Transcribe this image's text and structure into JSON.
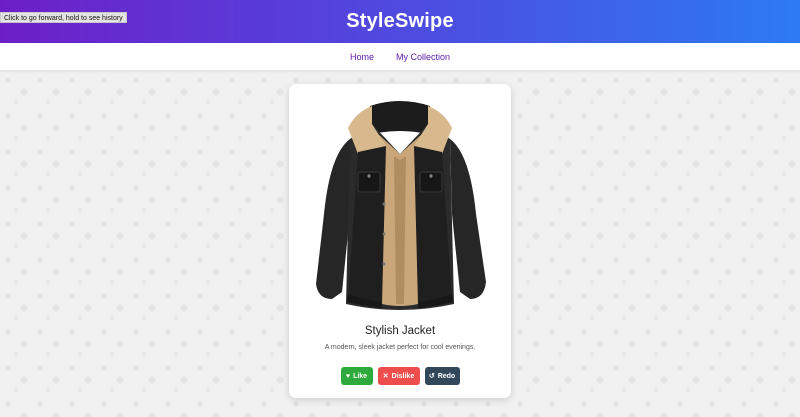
{
  "header": {
    "brand": "StyleSwipe",
    "tooltip": "Click to go forward, hold to see history"
  },
  "nav": {
    "home": "Home",
    "collection": "My Collection"
  },
  "card": {
    "title": "Stylish Jacket",
    "description": "A modern, sleek jacket perfect for cool evenings.",
    "image_icon": "jacket-image"
  },
  "actions": {
    "like_label": "Like",
    "like_icon": "♥",
    "dislike_label": "Dislike",
    "dislike_icon": "✕",
    "redo_label": "Redo",
    "redo_icon": "↺"
  },
  "colors": {
    "header_start": "#6d1fc7",
    "header_end": "#2c7bf2",
    "nav_link": "#5b1aa8",
    "like": "#2eaa3c",
    "dislike": "#ee4d4d",
    "redo": "#33475b"
  }
}
